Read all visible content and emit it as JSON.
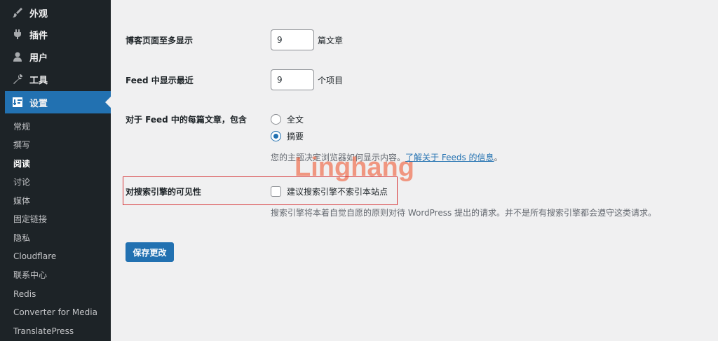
{
  "sidebar": {
    "top_items": [
      {
        "label": "外观",
        "icon": "paintbrush-icon"
      },
      {
        "label": "插件",
        "icon": "plugin-icon"
      },
      {
        "label": "用户",
        "icon": "user-icon"
      },
      {
        "label": "工具",
        "icon": "wrench-icon"
      },
      {
        "label": "设置",
        "icon": "settings-icon"
      }
    ],
    "submenu": [
      "常规",
      "撰写",
      "阅读",
      "讨论",
      "媒体",
      "固定链接",
      "隐私",
      "Cloudflare",
      "联系中心",
      "Redis",
      "Converter for Media",
      "TranslatePress"
    ]
  },
  "settings": {
    "posts_per_page": {
      "label": "博客页面至多显示",
      "value": "9",
      "suffix": "篇文章"
    },
    "feed_count": {
      "label": "Feed 中显示最近",
      "value": "9",
      "suffix": "个项目"
    },
    "feed_content": {
      "label": "对于 Feed 中的每篇文章，包含",
      "options": [
        "全文",
        "摘要"
      ],
      "selected": "摘要",
      "description": "您的主题决定浏览器如何显示内容。",
      "description_link": "了解关于 Feeds 的信息",
      "description_end": "。"
    },
    "search_visibility": {
      "label": "对搜索引擎的可见性",
      "checkbox_label": "建议搜索引擎不索引本站点",
      "checked": false,
      "description": "搜索引擎将本着自觉自愿的原则对待 WordPress 提出的请求。并不是所有搜索引擎都会遵守这类请求。"
    },
    "save_button": "保存更改"
  },
  "watermark": "Linghang",
  "colors": {
    "accent": "#2271b1",
    "sidebar": "#1d2327",
    "highlight": "#d63638"
  }
}
